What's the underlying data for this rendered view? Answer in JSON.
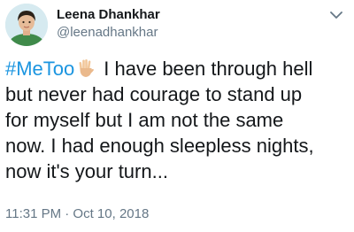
{
  "author": {
    "name": "Leena Dhankhar",
    "handle": "@leenadhankhar"
  },
  "tweet": {
    "hashtag": "#MeToo",
    "lines": [
      "I have been through hell",
      "but never had courage to stand up",
      "for myself but I am not the same",
      "now. I had enough sleepless nights,",
      "now it's your turn..."
    ],
    "timestamp": "11:31 PM · Oct 10, 2018"
  },
  "icons": {
    "menu": "chevron-down-icon",
    "emoji": "raised-hand-emoji"
  },
  "colors": {
    "link": "#1b95e0",
    "secondary_text": "#657786",
    "primary_text": "#14171a"
  }
}
